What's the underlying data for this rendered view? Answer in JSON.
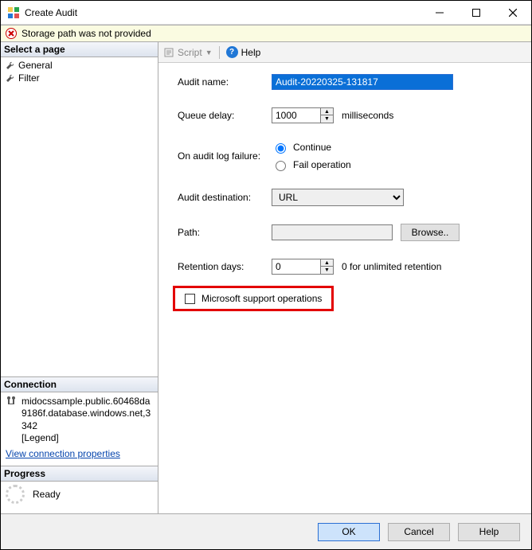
{
  "window": {
    "title": "Create Audit"
  },
  "error": {
    "message": "Storage path was not provided"
  },
  "left": {
    "select_page": "Select a page",
    "pages": [
      "General",
      "Filter"
    ],
    "connection_header": "Connection",
    "connection_text": "midocssample.public.60468da9186f.database.windows.net,3342\n[Legend]",
    "view_conn_props": "View connection properties",
    "progress_header": "Progress",
    "progress_status": "Ready"
  },
  "toolbar": {
    "script": "Script",
    "help": "Help"
  },
  "form": {
    "audit_name_label": "Audit name:",
    "audit_name_value": "Audit-20220325-131817",
    "queue_delay_label": "Queue delay:",
    "queue_delay_value": "1000",
    "queue_delay_suffix": "milliseconds",
    "on_failure_label": "On audit log failure:",
    "radio_continue": "Continue",
    "radio_fail": "Fail operation",
    "radio_selected": "continue",
    "destination_label": "Audit destination:",
    "destination_value": "URL",
    "path_label": "Path:",
    "path_value": "",
    "browse": "Browse..",
    "retention_label": "Retention days:",
    "retention_value": "0",
    "retention_suffix": "0 for unlimited retention",
    "checkbox_label": "Microsoft support operations"
  },
  "footer": {
    "ok": "OK",
    "cancel": "Cancel",
    "help": "Help"
  }
}
